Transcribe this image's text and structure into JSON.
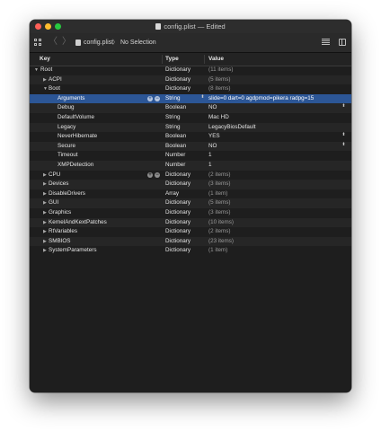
{
  "window": {
    "title": "config.plist — Edited"
  },
  "toolbar": {
    "file_name": "config.plist",
    "breadcrumb_separator": "〉",
    "selection_label": "No Selection"
  },
  "columns": {
    "key": "Key",
    "type": "Type",
    "value": "Value"
  },
  "rows": [
    {
      "key": "Root",
      "type": "Dictionary",
      "value": "(11 items)"
    },
    {
      "key": "ACPI",
      "type": "Dictionary",
      "value": "(5 items)"
    },
    {
      "key": "Boot",
      "type": "Dictionary",
      "value": "(8 items)"
    },
    {
      "key": "Arguments",
      "type": "String",
      "value": "slide=0 dart=0 agdpmod=pikera radpg=15"
    },
    {
      "key": "Debug",
      "type": "Boolean",
      "value": "NO"
    },
    {
      "key": "DefaultVolume",
      "type": "String",
      "value": "Mac HD"
    },
    {
      "key": "Legacy",
      "type": "String",
      "value": "LegacyBiosDefault"
    },
    {
      "key": "NeverHibernate",
      "type": "Boolean",
      "value": "YES"
    },
    {
      "key": "Secure",
      "type": "Boolean",
      "value": "NO"
    },
    {
      "key": "Timeout",
      "type": "Number",
      "value": "1"
    },
    {
      "key": "XMPDetection",
      "type": "Number",
      "value": "1"
    },
    {
      "key": "CPU",
      "type": "Dictionary",
      "value": "(2 items)"
    },
    {
      "key": "Devices",
      "type": "Dictionary",
      "value": "(3 items)"
    },
    {
      "key": "DisableDrivers",
      "type": "Array",
      "value": "(1 item)"
    },
    {
      "key": "GUI",
      "type": "Dictionary",
      "value": "(5 items)"
    },
    {
      "key": "Graphics",
      "type": "Dictionary",
      "value": "(3 items)"
    },
    {
      "key": "KernelAndKextPatches",
      "type": "Dictionary",
      "value": "(10 items)"
    },
    {
      "key": "RtVariables",
      "type": "Dictionary",
      "value": "(2 items)"
    },
    {
      "key": "SMBIOS",
      "type": "Dictionary",
      "value": "(23 items)"
    },
    {
      "key": "SystemParameters",
      "type": "Dictionary",
      "value": "(1 item)"
    }
  ],
  "row_controls": {
    "add": "+",
    "remove": "−"
  },
  "icons": {
    "disclosure_open": "▼",
    "disclosure_closed": "▶",
    "stepper": "⬍",
    "nav_back": "〈",
    "nav_forward": "〉"
  },
  "colors": {
    "selection": "#2c5696",
    "close": "#fe5f57",
    "minimize": "#febc2e",
    "maximize": "#28c840"
  }
}
